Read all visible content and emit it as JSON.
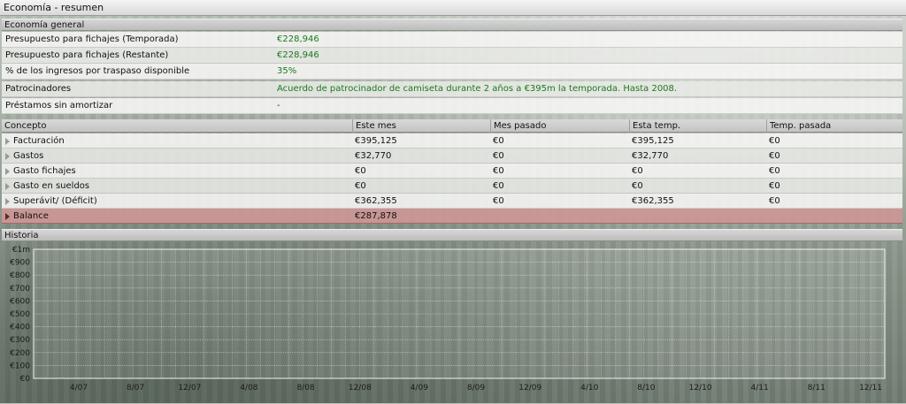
{
  "window": {
    "title": "Economía - resumen"
  },
  "general": {
    "header": "Economía general",
    "rows": [
      {
        "label": "Presupuesto para fichajes (Temporada)",
        "value": "€228,946"
      },
      {
        "label": "Presupuesto para fichajes (Restante)",
        "value": "€228,946"
      },
      {
        "label": "% de los ingresos por traspaso disponible",
        "value": "35%"
      },
      {
        "label": "Patrocinadores",
        "value": "Acuerdo de patrocinador de camiseta durante 2 años a €395m la temporada. Hasta 2008."
      },
      {
        "label": "Préstamos sin amortizar",
        "value": "-"
      }
    ]
  },
  "table": {
    "columns": [
      "Concepto",
      "Este mes",
      "Mes pasado",
      "Esta temp.",
      "Temp. pasada"
    ],
    "rows": [
      {
        "concept": "Facturación",
        "este_mes": "€395,125",
        "mes_pasado": "€0",
        "esta_temp": "€395,125",
        "temp_pasada": "€0"
      },
      {
        "concept": "Gastos",
        "este_mes": "€32,770",
        "mes_pasado": "€0",
        "esta_temp": "€32,770",
        "temp_pasada": "€0"
      },
      {
        "concept": "Gasto fichajes",
        "este_mes": "€0",
        "mes_pasado": "€0",
        "esta_temp": "€0",
        "temp_pasada": "€0"
      },
      {
        "concept": "Gasto en sueldos",
        "este_mes": "€0",
        "mes_pasado": "€0",
        "esta_temp": "€0",
        "temp_pasada": "€0"
      },
      {
        "concept": "Superávit/ (Déficit)",
        "este_mes": "€362,355",
        "mes_pasado": "€0",
        "esta_temp": "€362,355",
        "temp_pasada": "€0"
      },
      {
        "concept": "Balance",
        "este_mes": "€287,878",
        "mes_pasado": "",
        "esta_temp": "",
        "temp_pasada": ""
      }
    ]
  },
  "history": {
    "header": "Historia"
  },
  "chart_data": {
    "type": "line",
    "title": "",
    "xlabel": "",
    "ylabel": "",
    "ytick_labels": [
      "€1m",
      "€900",
      "€800",
      "€700",
      "€600",
      "€500",
      "€400",
      "€300",
      "€200",
      "€100",
      "€0"
    ],
    "xtick_labels": [
      "4/07",
      "8/07",
      "12/07",
      "4/08",
      "8/08",
      "12/08",
      "4/09",
      "8/09",
      "12/09",
      "4/10",
      "8/10",
      "12/10",
      "4/11",
      "8/11",
      "12/11"
    ],
    "grid": true,
    "series": []
  },
  "colors": {
    "value_green": "#1b7a1b",
    "balance_row": "#cd9696"
  }
}
